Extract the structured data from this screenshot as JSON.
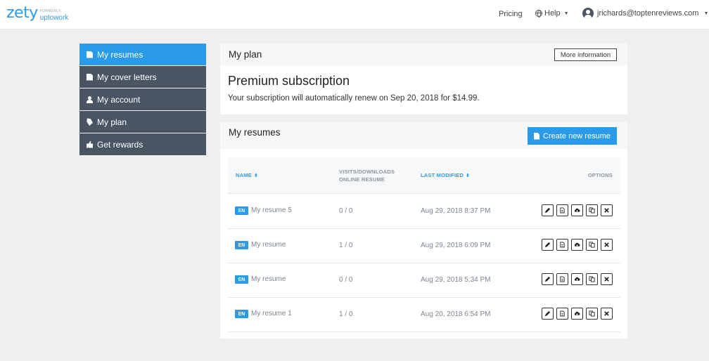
{
  "header": {
    "logo": {
      "main": "zety",
      "formerly": "FORMERLY",
      "brand": "uptowork"
    },
    "pricing_label": "Pricing",
    "help_label": "Help",
    "user_email": "jrichards@toptenreviews.com"
  },
  "sidebar": {
    "items": [
      {
        "label": "My resumes",
        "icon": "document-icon",
        "active": true
      },
      {
        "label": "My cover letters",
        "icon": "document-icon",
        "active": false
      },
      {
        "label": "My account",
        "icon": "user-icon",
        "active": false
      },
      {
        "label": "My plan",
        "icon": "tag-icon",
        "active": false
      },
      {
        "label": "Get rewards",
        "icon": "thumbs-up-icon",
        "active": false
      }
    ]
  },
  "plan": {
    "title": "My plan",
    "more_info_label": "More information",
    "subscription_title": "Premium subscription",
    "subscription_text": "Your subscription will automatically renew on Sep 20, 2018 for $14.99."
  },
  "resumes": {
    "title": "My resumes",
    "create_label": "Create new resume",
    "columns": {
      "name": "NAME",
      "visits_line1": "VISITS/DOWNLOADS",
      "visits_line2": "ONLINE RESUME",
      "modified": "LAST MODIFIED",
      "options": "OPTIONS"
    },
    "rows": [
      {
        "lang": "EN",
        "name": "My resume 5",
        "visits": "0 / 0",
        "modified": "Aug 29, 2018 8:37 PM"
      },
      {
        "lang": "EN",
        "name": "My resume",
        "visits": "1 / 0",
        "modified": "Aug 29, 2018 6:09 PM"
      },
      {
        "lang": "EN",
        "name": "My resume",
        "visits": "0 / 0",
        "modified": "Aug 29, 2018 5:34 PM"
      },
      {
        "lang": "EN",
        "name": "My resume 1",
        "visits": "1 / 0",
        "modified": "Aug 20, 2018 6:54 PM"
      }
    ],
    "row_actions": [
      "edit-icon",
      "pdf-icon",
      "cloud-download-icon",
      "duplicate-icon",
      "delete-icon"
    ]
  },
  "colors": {
    "accent": "#2b9ae8",
    "sidebar_bg": "#4a5563",
    "page_bg": "#efefef"
  }
}
